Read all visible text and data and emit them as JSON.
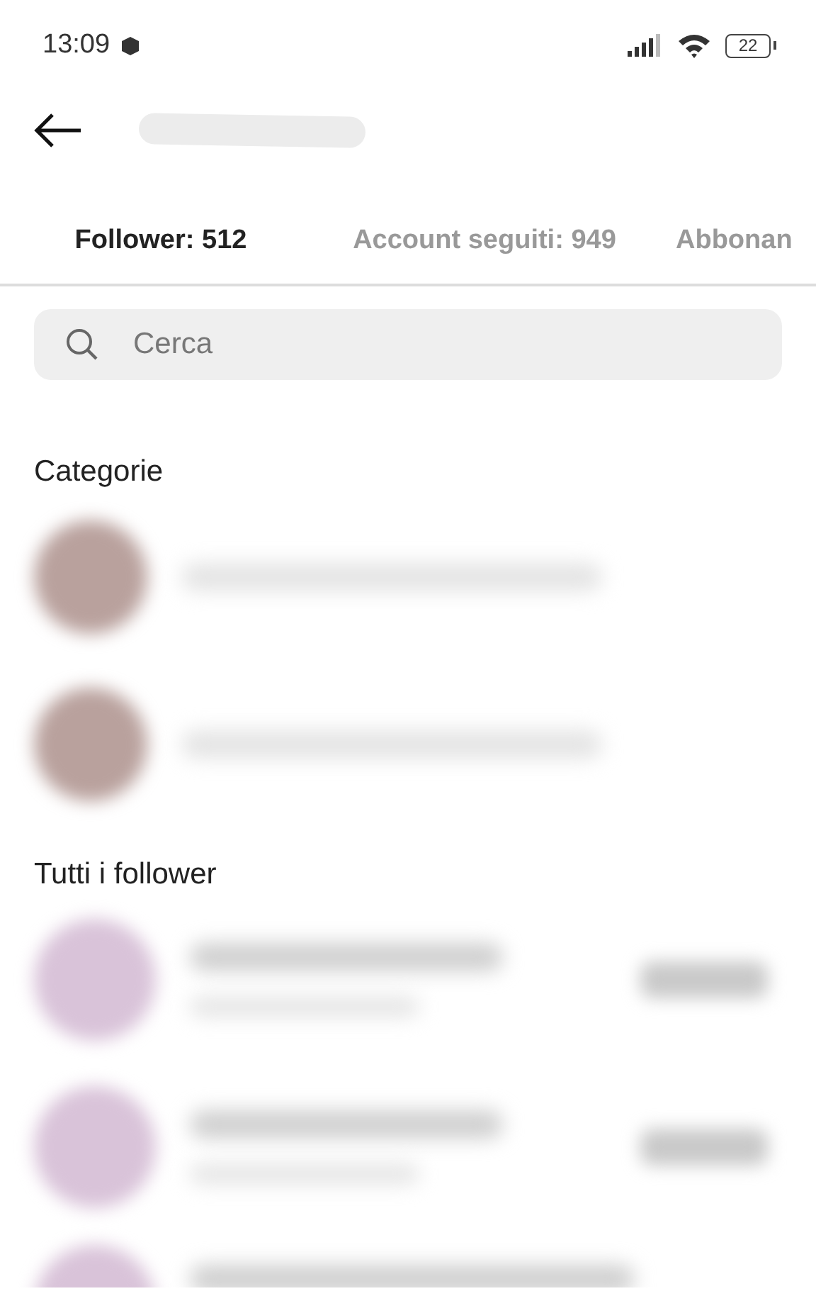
{
  "status_bar": {
    "time": "13:09",
    "battery": "22"
  },
  "tabs": [
    {
      "label": "Follower: 512",
      "selected": true
    },
    {
      "label": "Account seguiti: 949",
      "selected": false
    },
    {
      "label": "Abbonan",
      "selected": false
    }
  ],
  "search": {
    "placeholder": "Cerca"
  },
  "sections": [
    {
      "title": "Categorie",
      "rows": [
        {
          "kind": "category"
        },
        {
          "kind": "category"
        }
      ]
    },
    {
      "title": "Tutti i follower",
      "rows": [
        {
          "kind": "follower"
        },
        {
          "kind": "follower"
        },
        {
          "kind": "follower_top"
        }
      ]
    }
  ]
}
